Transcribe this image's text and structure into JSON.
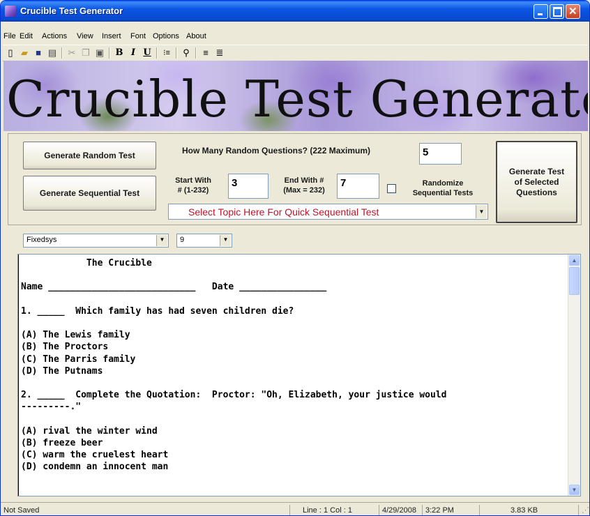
{
  "window": {
    "title": "Crucible Test Generator"
  },
  "menu": [
    "File",
    "Edit",
    "Actions",
    "View",
    "Insert",
    "Font",
    "Options",
    "About"
  ],
  "toolbar": {
    "icons": [
      "new-icon",
      "open-icon",
      "save-icon",
      "print-icon",
      "cut-icon",
      "copy-icon",
      "paste-icon",
      "bold-icon",
      "italic-icon",
      "underline-icon",
      "bullets-icon",
      "find-icon",
      "align-left-icon",
      "align-center-icon"
    ],
    "bold": "B",
    "italic": "I",
    "underline": "U"
  },
  "banner": {
    "title": "Crucible Test Generator"
  },
  "controls": {
    "random_button": "Generate Random Test",
    "sequential_button": "Generate Sequential Test",
    "how_many_label": "How Many Random Questions? (222 Maximum)",
    "how_many_value": "5",
    "start_label_1": "Start With",
    "start_label_2": "# (1-232)",
    "start_value": "3",
    "end_label_1": "End With #",
    "end_label_2": "(Max = 232)",
    "end_value": "7",
    "randomize_label_1": "Randomize",
    "randomize_label_2": "Sequential Tests",
    "randomize_checked": false,
    "topic_select": "Select Topic Here For Quick Sequential Test",
    "selected_button_1": "Generate Test",
    "selected_button_2": "of Selected",
    "selected_button_3": "Questions"
  },
  "format": {
    "font": "Fixedsys",
    "size": "9"
  },
  "document": {
    "lines": [
      "            The Crucible",
      "",
      "Name ___________________________   Date ________________",
      "",
      "1. _____  Which family has had seven children die?",
      "",
      "(A) The Lewis family",
      "(B) The Proctors",
      "(C) The Parris family",
      "(D) The Putnams",
      "",
      "2. _____  Complete the Quotation:  Proctor: \"Oh, Elizabeth, your justice would",
      "---------.\"",
      "",
      "(A) rival the winter wind",
      "(B) freeze beer",
      "(C) warm the cruelest heart",
      "(D) condemn an innocent man"
    ]
  },
  "status": {
    "saved": "Not Saved",
    "position": "Line : 1   Col : 1",
    "date": "4/29/2008",
    "time": "3:22 PM",
    "size": "3.83 KB"
  }
}
